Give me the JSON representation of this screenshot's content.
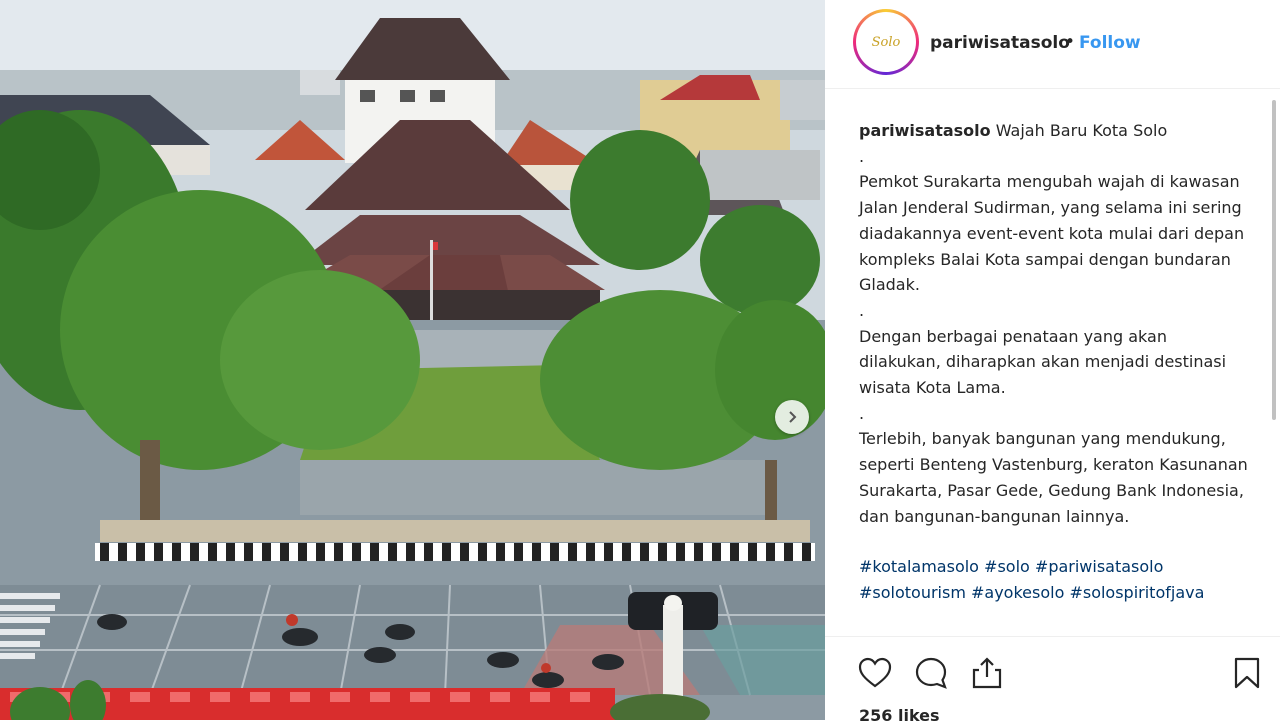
{
  "post": {
    "username": "pariwisatasolo",
    "separator": "•",
    "follow_label": "Follow",
    "avatar_logo_text": "Solo",
    "caption_user": "pariwisatasolo",
    "caption_title": "Wajah Baru Kota Solo",
    "caption_lines": [
      ".",
      "Pemkot Surakarta mengubah wajah di kawasan Jalan Jenderal Sudirman, yang selama ini sering diadakannya event-event kota mulai dari depan kompleks Balai Kota sampai dengan bundaran Gladak.",
      ".",
      "Dengan berbagai penataan yang akan dilakukan, diharapkan akan menjadi destinasi wisata Kota Lama.",
      ".",
      "Terlebih, banyak bangunan yang mendukung, seperti Benteng Vastenburg, keraton Kasunanan Surakarta, Pasar Gede, Gedung Bank Indonesia, dan bangunan-bangunan lainnya."
    ],
    "hashtags": "#kotalamasolo #solo #pariwisatasolo #solotourism #ayokesolo #solospiritofjava",
    "likes": "256 likes"
  },
  "icons": {
    "like": "heart-icon",
    "comment": "comment-icon",
    "share": "share-icon",
    "save": "bookmark-icon",
    "next": "chevron-right-icon"
  }
}
